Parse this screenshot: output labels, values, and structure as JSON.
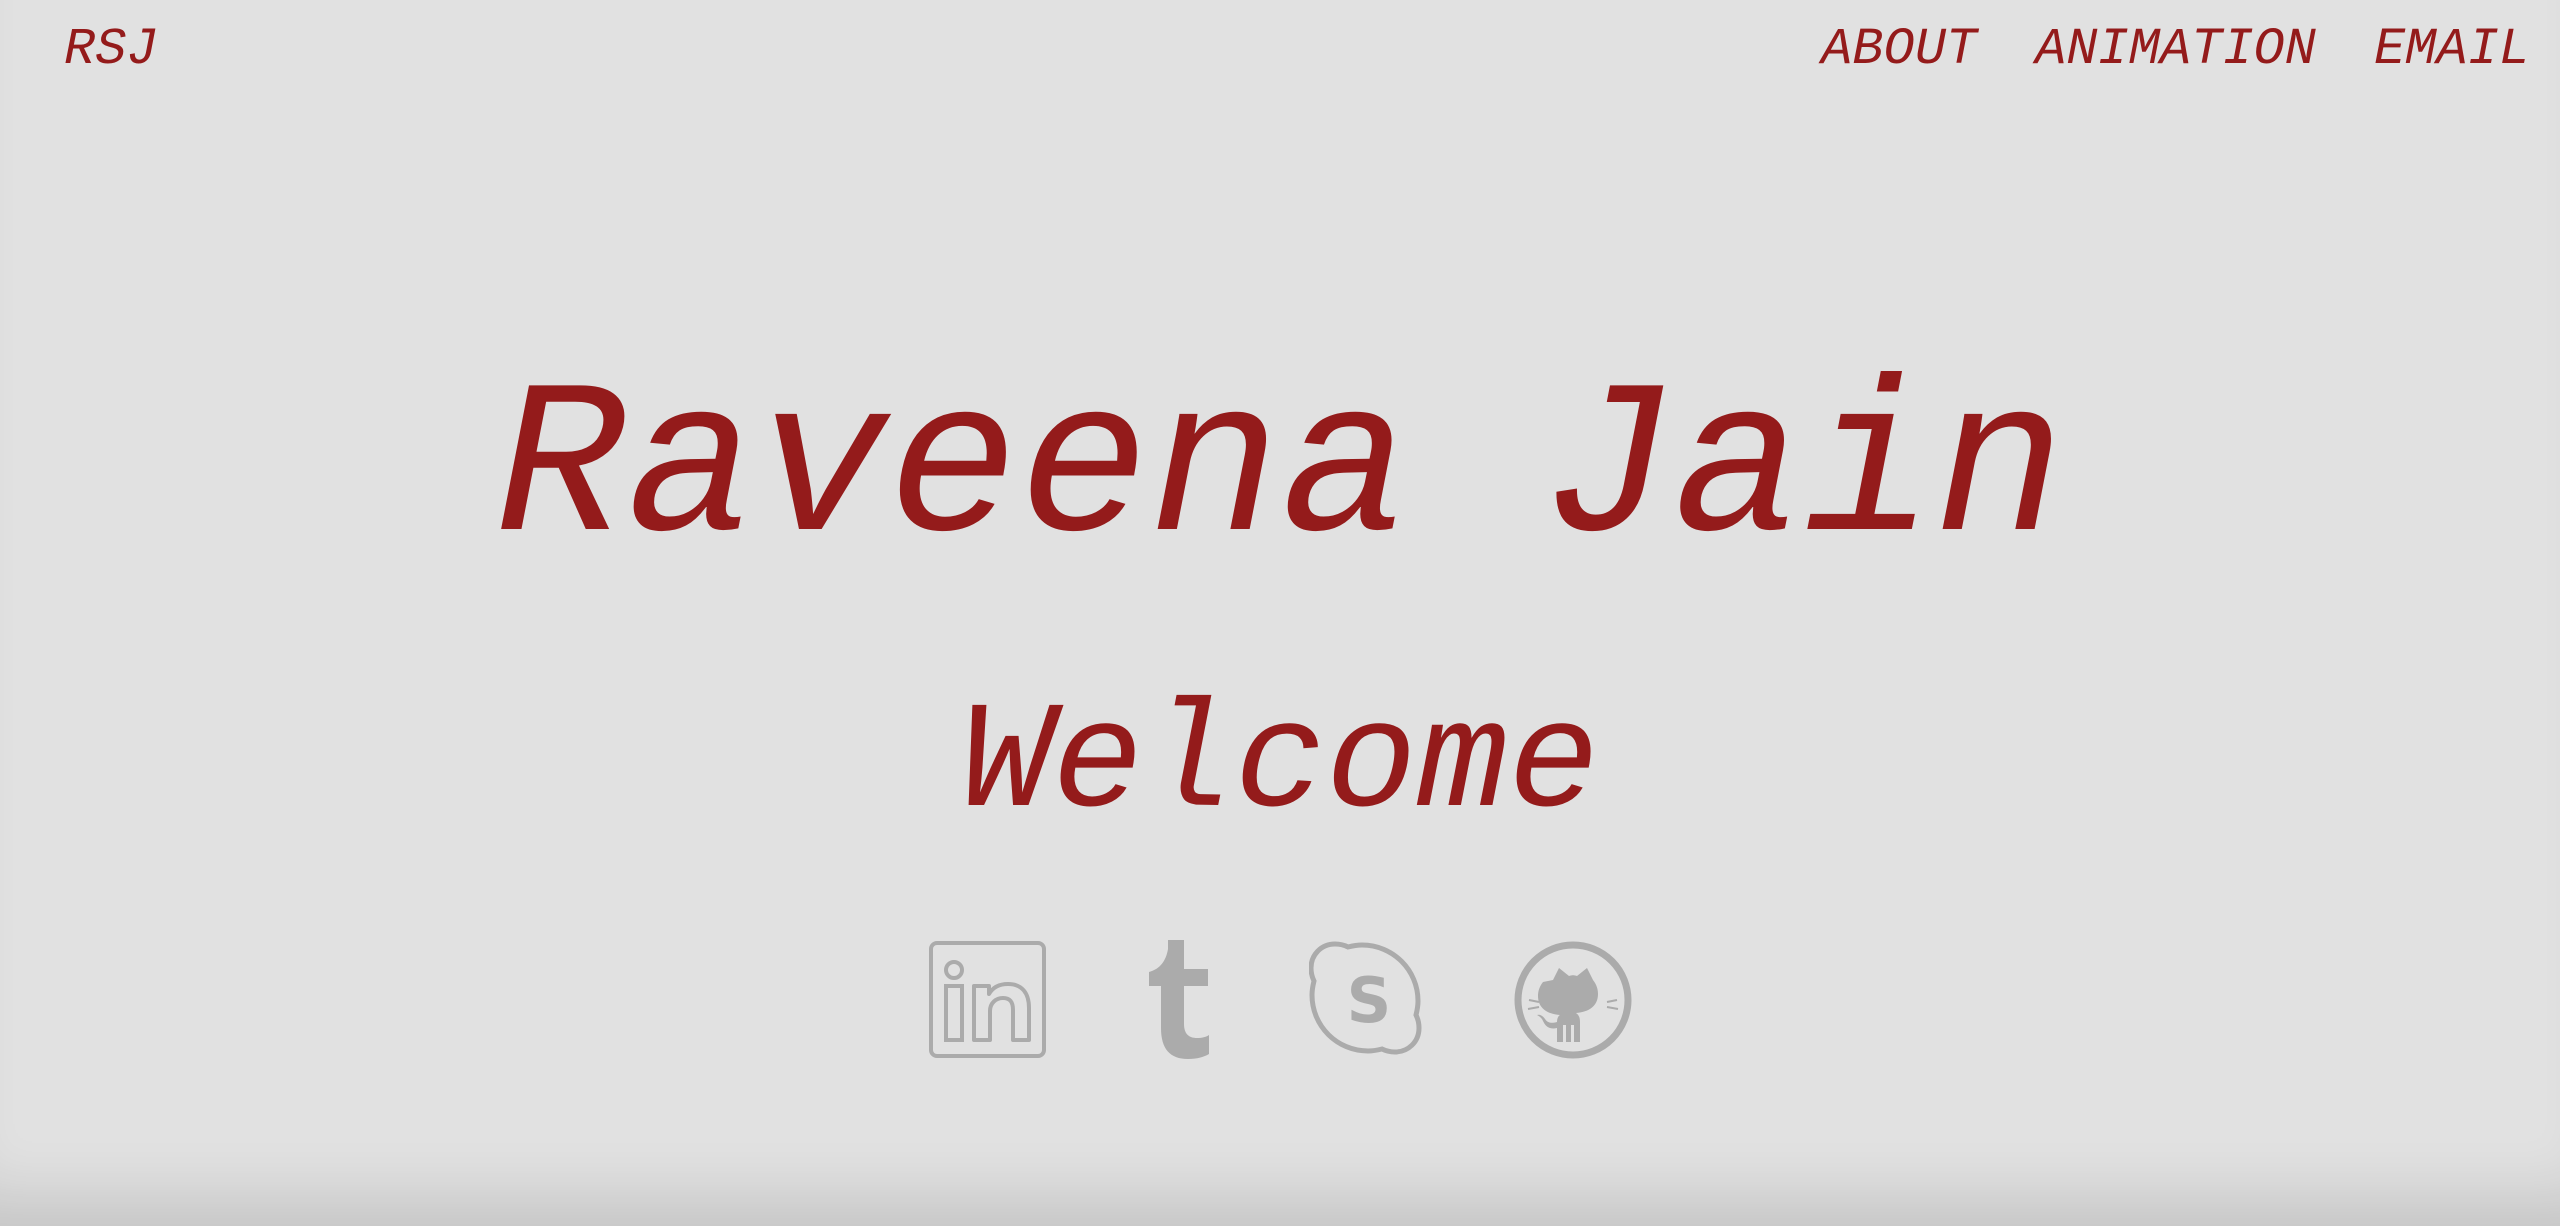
{
  "header": {
    "logo": "RSJ",
    "nav": [
      {
        "label": "ABOUT"
      },
      {
        "label": "ANIMATION"
      },
      {
        "label": "EMAIL"
      }
    ]
  },
  "hero": {
    "name": "Raveena Jain",
    "greeting": "Welcome"
  },
  "social": [
    {
      "icon": "linkedin-icon"
    },
    {
      "icon": "tumblr-icon"
    },
    {
      "icon": "skype-icon"
    },
    {
      "icon": "github-icon"
    }
  ],
  "colors": {
    "accent": "#941b1b",
    "background": "#e1e1e1",
    "icon": "#ababab"
  }
}
